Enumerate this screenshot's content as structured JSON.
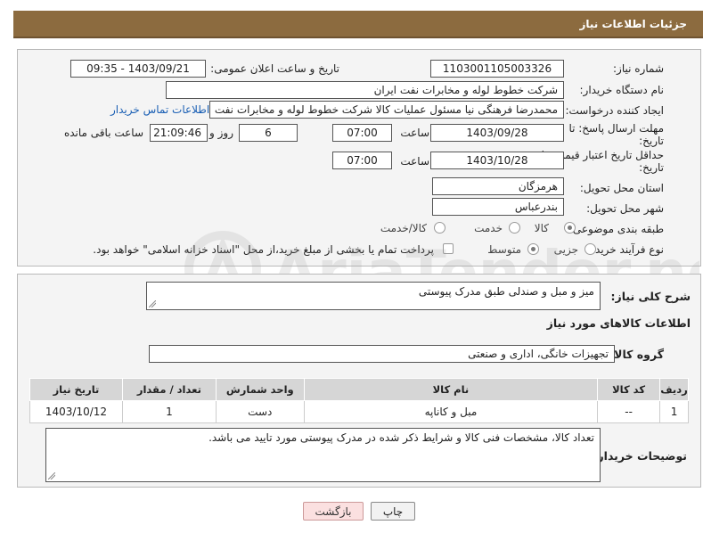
{
  "header": {
    "title": "جزئیات اطلاعات نیاز"
  },
  "form": {
    "need_number_label": "شماره نیاز:",
    "need_number": "1103001105003326",
    "announce_label": "تاریخ و ساعت اعلان عمومی:",
    "announce_value": "1403/09/21 - 09:35",
    "buyer_org_label": "نام دستگاه خریدار:",
    "buyer_org": "شرکت خطوط لوله و مخابرات نفت ایران",
    "requester_label": "ایجاد کننده درخواست:",
    "requester": "محمدرضا فرهنگی نیا مسئول عملیات کالا شرکت خطوط لوله و مخابرات نفت ایران",
    "contact_link": "اطلاعات تماس خریدار",
    "deadline_label_1": "مهلت ارسال پاسخ: تا",
    "deadline_label_2": "تاریخ:",
    "deadline_date": "1403/09/28",
    "time_label": "ساعت",
    "deadline_time": "07:00",
    "days_value": "6",
    "days_label": "روز و",
    "remaining_time": "21:09:46",
    "remaining_label": "ساعت باقی مانده",
    "validity_label_1": "حداقل تاریخ اعتبار قیمت: تا",
    "validity_label_2": "تاریخ:",
    "validity_date": "1403/10/28",
    "validity_time": "07:00",
    "province_label": "استان محل تحویل:",
    "province": "هرمزگان",
    "city_label": "شهر محل تحویل:",
    "city": "بندرعباس",
    "category_label": "طبقه بندی موضوعی:",
    "category_options": [
      "کالا",
      "خدمت",
      "کالا/خدمت"
    ],
    "process_label": "نوع فرآیند خرید :",
    "process_options": [
      "جزیی",
      "متوسط"
    ],
    "payment_note": "پرداخت تمام یا بخشی از مبلغ خرید،از محل \"اسناد خزانه اسلامی\" خواهد بود."
  },
  "goods": {
    "desc_label": "شرح کلی نیاز:",
    "desc": "میز و مبل و صندلی طبق مدرک پیوستی",
    "info_title": "اطلاعات کالاهای مورد نیاز",
    "group_label": "گروه کالا:",
    "group": "تجهیزات خانگی، اداری و صنعتی",
    "table": {
      "headers": [
        "ردیف",
        "کد کالا",
        "نام کالا",
        "واحد شمارش",
        "تعداد / مقدار",
        "تاریخ نیاز"
      ],
      "rows": [
        [
          "1",
          "--",
          "مبل و کاناپه",
          "دست",
          "1",
          "1403/10/12"
        ]
      ]
    },
    "buyer_notes_label": "توضیحات خریدار:",
    "buyer_notes": "تعداد کالا، مشخصات فنی کالا و شرایط ذکر شده در مدرک پیوستی مورد تایید می باشد."
  },
  "buttons": {
    "print": "چاپ",
    "back": "بازگشت"
  },
  "watermark": {
    "text": "AriaTender.net"
  },
  "colors": {
    "header_bg": "#8c6b3f",
    "link": "#1a5fb4",
    "back_btn_bg": "#fbe0e0"
  }
}
